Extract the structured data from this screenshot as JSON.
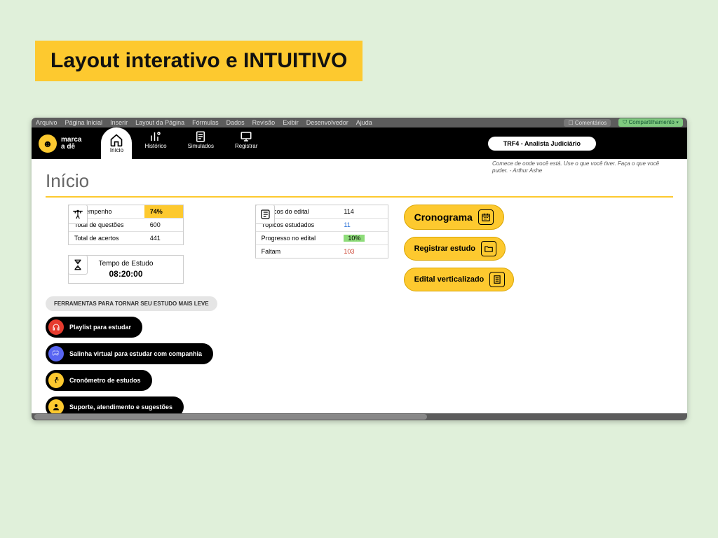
{
  "slide_title": "Layout interativo e INTUITIVO",
  "menubar": [
    "Arquivo",
    "Página Inicial",
    "Inserir",
    "Layout da Página",
    "Fórmulas",
    "Dados",
    "Revisão",
    "Exibir",
    "Desenvolvedor",
    "Ajuda"
  ],
  "menubar_right": {
    "comments": "Comentários",
    "share": "Compartilhamento"
  },
  "logo_text_1": "marca",
  "logo_text_2": "a dê",
  "tabs": [
    {
      "key": "inicio",
      "label": "Início"
    },
    {
      "key": "historico",
      "label": "Histórico"
    },
    {
      "key": "simulados",
      "label": "Simulados"
    },
    {
      "key": "registrar",
      "label": "Registrar"
    }
  ],
  "course": "TRF4 - Analista Judiciário",
  "quote": "Comece de onde você está. Use o que você tiver. Faça o que você puder. - Arthur Ashe",
  "page_heading": "Início",
  "perf": {
    "rows": [
      {
        "label": "Desempenho",
        "value": "74%",
        "hl": "yellow"
      },
      {
        "label": "Total de questões",
        "value": "600"
      },
      {
        "label": "Total de acertos",
        "value": "441"
      }
    ]
  },
  "topics": {
    "rows": [
      {
        "label": "Tópicos do edital",
        "value": "114"
      },
      {
        "label": "Tópicos estudados",
        "value": "11",
        "hl": "blue"
      },
      {
        "label": "Progresso no edital",
        "value": "10%",
        "hl": "green"
      },
      {
        "label": "Faltam",
        "value": "103",
        "hl": "red"
      }
    ]
  },
  "time": {
    "label": "Tempo de Estudo",
    "value": "08:20:00"
  },
  "actions": {
    "cronograma": "Cronograma",
    "registrar": "Registrar estudo",
    "edital": "Edital verticalizado"
  },
  "tools_heading": "FERRAMENTAS PARA TORNAR SEU ESTUDO MAIS LEVE",
  "tools": [
    {
      "key": "playlist",
      "label": "Playlist para estudar"
    },
    {
      "key": "salinha",
      "label": "Salinha virtual para estudar com companhia"
    },
    {
      "key": "cronometro",
      "label": "Cronômetro de estudos"
    },
    {
      "key": "suporte",
      "label": "Suporte,  atendimento e sugestões"
    }
  ]
}
